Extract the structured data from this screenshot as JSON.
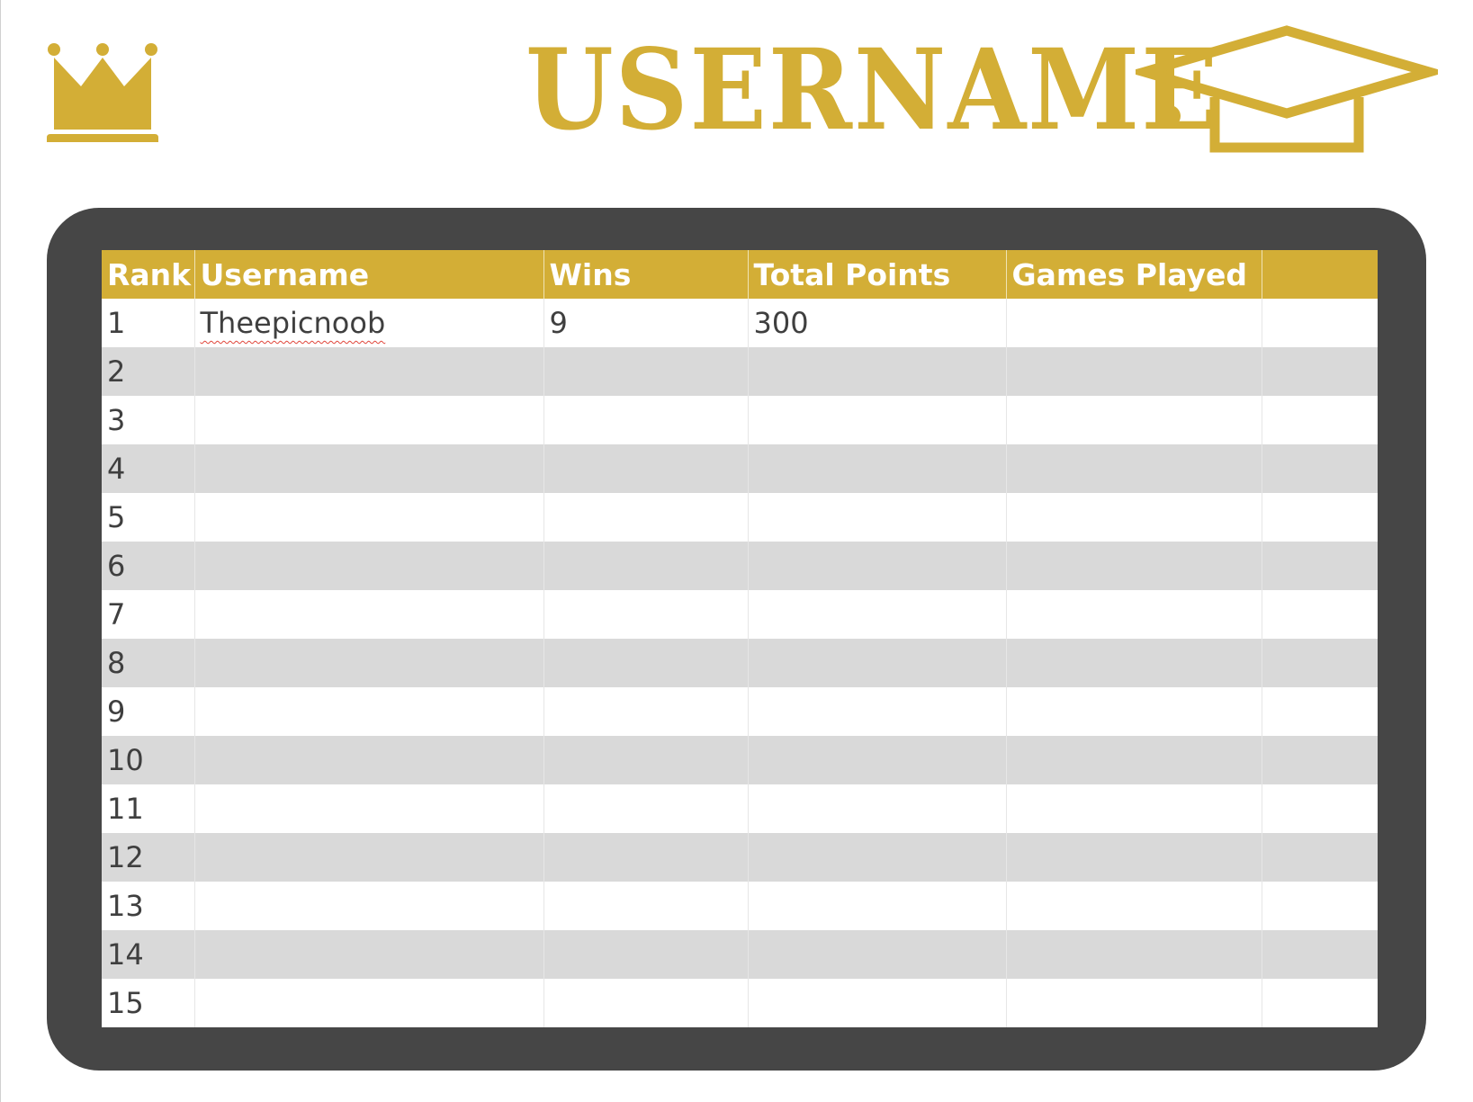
{
  "header": {
    "title": "USERNAME",
    "accent_color": "#d3ae36",
    "left_icon": "crown-icon",
    "right_icon": "graduation-cap-icon"
  },
  "frame_color": "#464646",
  "leaderboard": {
    "columns": [
      "Rank",
      "Username",
      "Wins",
      "Total Points",
      "Games Played",
      ""
    ],
    "rows": [
      [
        "1",
        "Theepicnoob",
        "9",
        "300",
        "",
        ""
      ],
      [
        "2",
        "",
        "",
        "",
        "",
        ""
      ],
      [
        "3",
        "",
        "",
        "",
        "",
        ""
      ],
      [
        "4",
        "",
        "",
        "",
        "",
        ""
      ],
      [
        "5",
        "",
        "",
        "",
        "",
        ""
      ],
      [
        "6",
        "",
        "",
        "",
        "",
        ""
      ],
      [
        "7",
        "",
        "",
        "",
        "",
        ""
      ],
      [
        "8",
        "",
        "",
        "",
        "",
        ""
      ],
      [
        "9",
        "",
        "",
        "",
        "",
        ""
      ],
      [
        "10",
        "",
        "",
        "",
        "",
        ""
      ],
      [
        "11",
        "",
        "",
        "",
        "",
        ""
      ],
      [
        "12",
        "",
        "",
        "",
        "",
        ""
      ],
      [
        "13",
        "",
        "",
        "",
        "",
        ""
      ],
      [
        "14",
        "",
        "",
        "",
        "",
        ""
      ],
      [
        "15",
        "",
        "",
        "",
        "",
        ""
      ]
    ]
  }
}
